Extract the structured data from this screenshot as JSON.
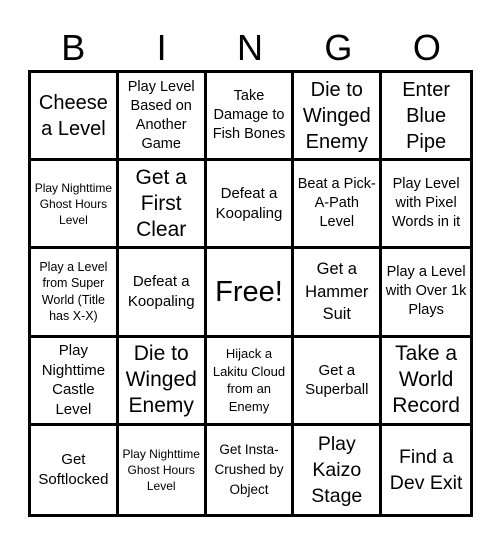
{
  "header": {
    "letters": [
      "B",
      "I",
      "N",
      "G",
      "O"
    ]
  },
  "card": {
    "rows": [
      [
        "Cheese a Level",
        "Play Level Based on Another Game",
        "Take Damage to Fish Bones",
        "Die to Winged Enemy",
        "Enter Blue Pipe"
      ],
      [
        "Play Nighttime Ghost Hours Level",
        "Get a First Clear",
        "Defeat a Koopaling",
        "Beat a Pick-A-Path Level",
        "Play Level with Pixel Words in it"
      ],
      [
        "Play a Level from Super World (Title has X-X)",
        "Defeat a Koopaling",
        "Free!",
        "Get a Hammer Suit",
        "Play a Level with Over 1k Plays"
      ],
      [
        "Play Nighttime Castle Level",
        "Die to Winged Enemy",
        "Hijack a Lakitu Cloud from an Enemy",
        "Get a Superball",
        "Take a World Record"
      ],
      [
        "Get Softlocked",
        "Play Nighttime Ghost Hours Level",
        "Get Insta-Crushed by Object",
        "Play Kaizo Stage",
        "Find a Dev Exit"
      ]
    ],
    "free_space": {
      "row": 2,
      "col": 2
    }
  }
}
